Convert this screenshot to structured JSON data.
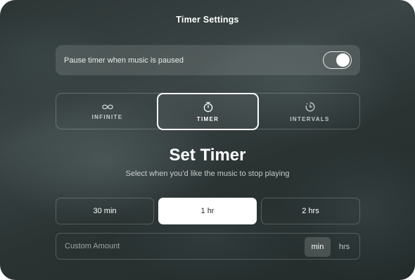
{
  "title": "Timer Settings",
  "pause_toggle": {
    "label": "Pause timer when music is paused",
    "enabled": true
  },
  "modes": [
    {
      "label": "INFINITE",
      "icon": "infinity-icon",
      "active": false
    },
    {
      "label": "TIMER",
      "icon": "stopwatch-icon",
      "active": true
    },
    {
      "label": "INTERVALS",
      "icon": "intervals-clock-icon",
      "active": false
    }
  ],
  "heading": "Set Timer",
  "subheading": "Select when you’d like the music to stop playing",
  "presets": [
    {
      "label": "30 min",
      "active": false
    },
    {
      "label": "1 hr",
      "active": true
    },
    {
      "label": "2 hrs",
      "active": false
    }
  ],
  "custom": {
    "placeholder": "Custom Amount",
    "value": "",
    "units": [
      {
        "label": "min",
        "active": true
      },
      {
        "label": "hrs",
        "active": false
      }
    ]
  }
}
